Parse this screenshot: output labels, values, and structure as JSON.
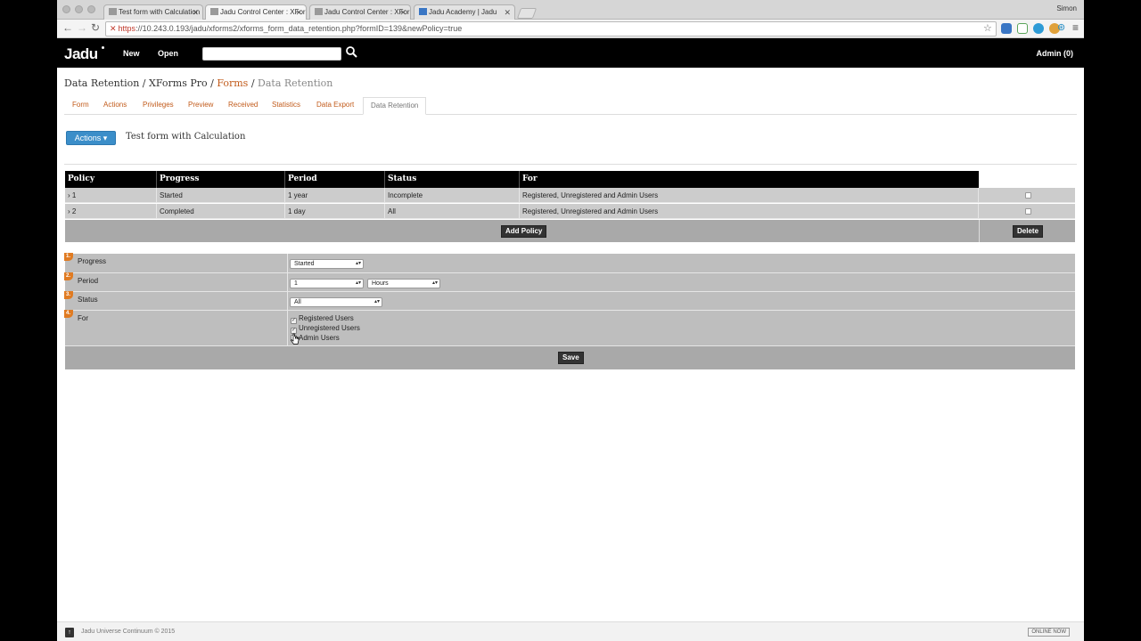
{
  "browser": {
    "tabs": [
      {
        "title": "Test form with Calculation"
      },
      {
        "title": "Jadu Control Center : XForm"
      },
      {
        "title": "Jadu Control Center : XFor"
      },
      {
        "title": "Jadu Academy | Jadu"
      }
    ],
    "profile": "Simon",
    "url_https": "https",
    "url_rest": "://10.243.0.193/jadu/xforms2/xforms_form_data_retention.php?formID=139&newPolicy=true"
  },
  "app": {
    "logo": "Jadu",
    "nav_new": "New",
    "nav_open": "Open",
    "admin": "Admin (0)"
  },
  "breadcrumb": {
    "part1": "Data Retention",
    "sep": " / ",
    "part2": "XForms Pro",
    "part3": "Forms",
    "part4": "Data Retention"
  },
  "subtabs": [
    "Form",
    "Actions",
    "Privileges",
    "Preview",
    "Received",
    "Statistics",
    "Data Export",
    "Data Retention"
  ],
  "actions_button": "Actions ▾",
  "form_title": "Test form with Calculation",
  "policy_table": {
    "headers": [
      "Policy",
      "Progress",
      "Period",
      "Status",
      "For"
    ],
    "rows": [
      {
        "policy": "› 1",
        "progress": "Started",
        "period": "1 year",
        "status": "Incomplete",
        "for": "Registered, Unregistered and Admin Users"
      },
      {
        "policy": "› 2",
        "progress": "Completed",
        "period": "1 day",
        "status": "All",
        "for": "Registered, Unregistered and Admin Users"
      }
    ],
    "add_policy": "Add Policy",
    "delete": "Delete"
  },
  "edit_form": {
    "progress": {
      "num": "1.",
      "label": "Progress",
      "value": "Started"
    },
    "period": {
      "num": "2.",
      "label": "Period",
      "value": "1",
      "unit": "Hours"
    },
    "status": {
      "num": "3.",
      "label": "Status",
      "value": "All"
    },
    "for": {
      "num": "4.",
      "label": "For",
      "options": [
        {
          "label": "Registered Users",
          "checked": true
        },
        {
          "label": "Unregistered Users",
          "checked": true
        },
        {
          "label": "Admin Users",
          "checked": false
        }
      ]
    },
    "save": "Save"
  },
  "footer": {
    "text": "Jadu Universe Continuum © 2015",
    "status": "ONLINE NOW"
  }
}
